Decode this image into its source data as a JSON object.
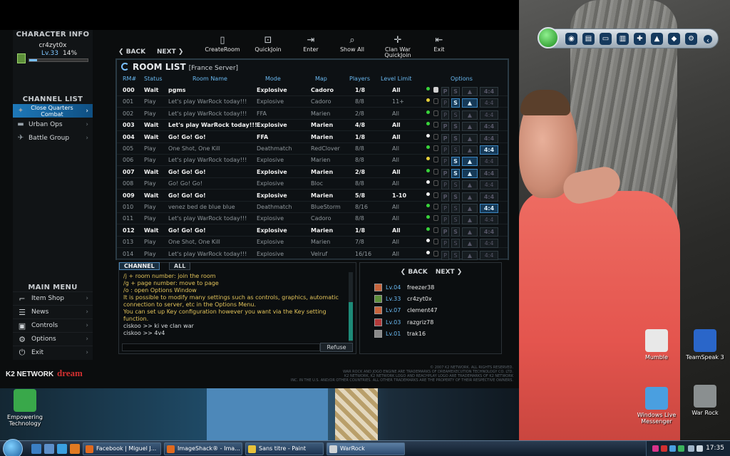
{
  "character_info": {
    "title": "CHARACTER INFO",
    "name": "cr4zyt0x",
    "level": "Lv.33",
    "xp_percent": "14%",
    "xp_fraction": 0.14
  },
  "channel_list": {
    "title": "CHANNEL LIST",
    "items": [
      {
        "label": "Close Quarters Combat",
        "active": true
      },
      {
        "label": "Urban Ops",
        "active": false
      },
      {
        "label": "Battle Group",
        "active": false
      }
    ]
  },
  "main_menu": {
    "title": "MAIN MENU",
    "items": [
      {
        "label": "Item Shop",
        "icon": "gun-icon"
      },
      {
        "label": "News",
        "icon": "news-icon"
      },
      {
        "label": "Controls",
        "icon": "controls-icon"
      },
      {
        "label": "Options",
        "icon": "gear-icon"
      },
      {
        "label": "Exit",
        "icon": "power-icon"
      }
    ]
  },
  "toolbar": {
    "back": "BACK",
    "next": "NEXT",
    "tools": [
      {
        "label": "CreateRoom",
        "icon": "create-room-icon"
      },
      {
        "label": "QuickJoin",
        "icon": "quick-join-icon"
      },
      {
        "label": "Enter",
        "icon": "enter-icon"
      },
      {
        "label": "Show All",
        "icon": "search-icon"
      },
      {
        "label": "Clan War QuickJoin",
        "icon": "clan-war-icon"
      },
      {
        "label": "Exit",
        "icon": "exit-icon"
      }
    ]
  },
  "room_list": {
    "title": "ROOM LIST",
    "server": "[France Server]",
    "columns": [
      "RM#",
      "Status",
      "Room Name",
      "Mode",
      "Map",
      "Players",
      "Level Limit",
      "Options"
    ],
    "rows": [
      {
        "num": "000",
        "status": "Wait",
        "name": "pgms",
        "mode": "Explosive",
        "map": "Cadoro",
        "players": "1/8",
        "level": "All",
        "dot": "green",
        "locked": true,
        "badge": ""
      },
      {
        "num": "001",
        "status": "Play",
        "name": "Let's play WarRock today!!!",
        "mode": "Explosive",
        "map": "Cadoro",
        "players": "8/8",
        "level": "11+",
        "dot": "yellow",
        "locked": false,
        "badge": "S"
      },
      {
        "num": "002",
        "status": "Play",
        "name": "Let's play WarRock today!!!",
        "mode": "FFA",
        "map": "Marien",
        "players": "2/8",
        "level": "All",
        "dot": "green",
        "locked": false,
        "badge": ""
      },
      {
        "num": "003",
        "status": "Wait",
        "name": "Let's play WarRock today!!!",
        "mode": "Explosive",
        "map": "Marien",
        "players": "4/8",
        "level": "All",
        "dot": "green",
        "locked": false,
        "badge": ""
      },
      {
        "num": "004",
        "status": "Wait",
        "name": "Go! Go! Go!",
        "mode": "FFA",
        "map": "Marien",
        "players": "1/8",
        "level": "All",
        "dot": "white",
        "locked": false,
        "badge": ""
      },
      {
        "num": "005",
        "status": "Play",
        "name": "One Shot, One Kill",
        "mode": "Deathmatch",
        "map": "RedClover",
        "players": "8/8",
        "level": "All",
        "dot": "green",
        "locked": false,
        "badge": "4:4"
      },
      {
        "num": "006",
        "status": "Play",
        "name": "Let's play WarRock today!!!",
        "mode": "Explosive",
        "map": "Marien",
        "players": "8/8",
        "level": "All",
        "dot": "yellow",
        "locked": false,
        "badge": "S"
      },
      {
        "num": "007",
        "status": "Wait",
        "name": "Go! Go! Go!",
        "mode": "Explosive",
        "map": "Marien",
        "players": "2/8",
        "level": "All",
        "dot": "green",
        "locked": false,
        "badge": "S"
      },
      {
        "num": "008",
        "status": "Play",
        "name": "Go! Go! Go!",
        "mode": "Explosive",
        "map": "Bloc",
        "players": "8/8",
        "level": "All",
        "dot": "white",
        "locked": false,
        "badge": ""
      },
      {
        "num": "009",
        "status": "Wait",
        "name": "Go! Go! Go!",
        "mode": "Explosive",
        "map": "Marien",
        "players": "5/8",
        "level": "1-10",
        "dot": "white",
        "locked": false,
        "badge": ""
      },
      {
        "num": "010",
        "status": "Play",
        "name": "venez bed de blue blue",
        "mode": "Deathmatch",
        "map": "BlueStorm",
        "players": "8/16",
        "level": "All",
        "dot": "green",
        "locked": false,
        "badge": "4:4"
      },
      {
        "num": "011",
        "status": "Play",
        "name": "Let's play WarRock today!!!",
        "mode": "Explosive",
        "map": "Cadoro",
        "players": "8/8",
        "level": "All",
        "dot": "green",
        "locked": false,
        "badge": ""
      },
      {
        "num": "012",
        "status": "Wait",
        "name": "Go! Go! Go!",
        "mode": "Explosive",
        "map": "Marien",
        "players": "1/8",
        "level": "All",
        "dot": "green",
        "locked": false,
        "badge": ""
      },
      {
        "num": "013",
        "status": "Play",
        "name": "One Shot, One Kill",
        "mode": "Explosive",
        "map": "Marien",
        "players": "7/8",
        "level": "All",
        "dot": "white",
        "locked": false,
        "badge": ""
      },
      {
        "num": "014",
        "status": "Play",
        "name": "Let's play WarRock today!!!",
        "mode": "Explosive",
        "map": "Velruf",
        "players": "16/16",
        "level": "All",
        "dot": "white",
        "locked": false,
        "badge": ""
      }
    ]
  },
  "chat": {
    "tabs": [
      "CHANNEL",
      "ALL"
    ],
    "lines": [
      {
        "text": "/j + room number: join the room",
        "color": "#e2c35a"
      },
      {
        "text": "/g + page number: move to page",
        "color": "#e2c35a"
      },
      {
        "text": "/o : open Options Window",
        "color": "#e2c35a"
      },
      {
        "text": "It is possible to modify many settings such as controls, graphics, automatic",
        "color": "#e2c35a"
      },
      {
        "text": "connection to server, etc in the Options Menu.",
        "color": "#e2c35a"
      },
      {
        "text": "You can set up Key configuration however you want via the Key setting",
        "color": "#e2c35a"
      },
      {
        "text": "function.",
        "color": "#e2c35a"
      },
      {
        "text": "ciskoo    >> ki ve clan war",
        "color": "#d8dcdf"
      },
      {
        "text": "ciskoo    >> 4v4",
        "color": "#d8dcdf"
      }
    ],
    "refuse_label": "Refuse"
  },
  "player_list": {
    "back": "BACK",
    "next": "NEXT",
    "players": [
      {
        "level": "Lv.04",
        "name": "freezer38",
        "badge_color": "#c8643c"
      },
      {
        "level": "Lv.33",
        "name": "cr4zyt0x",
        "badge_color": "#5d8f3a"
      },
      {
        "level": "Lv.07",
        "name": "clement47",
        "badge_color": "#c8643c"
      },
      {
        "level": "Lv.03",
        "name": "razgriz78",
        "badge_color": "#b33a3a"
      },
      {
        "level": "Lv.01",
        "name": "trak16",
        "badge_color": "#8a8a8a"
      }
    ]
  },
  "footer": {
    "k2": "K2 NETWORK",
    "dream": "dream",
    "legal": [
      "© 2007 K2 NETWORK. ALL RIGHTS RESERVED.",
      "WAR ROCK AND JOGO ENGINE ARE TRADEMARKS OF DREAMEXECUTION TECHNOLOGY CO. LTD.",
      "K2 NETWORK, K2 NETWORK LOGO AND REACHPLAY LOGO ARE TRADEMARKS OF K2 NETWORK",
      "INC. IN THE U.S. AND/OR OTHER COUNTRIES. ALL OTHER TRADEMARKS ARE THE PROPERTY OF THEIR RESPECTIVE OWNERS."
    ]
  },
  "desktop": {
    "icons": [
      {
        "label": "Empowering Technology",
        "color": "#39a84a"
      },
      {
        "label": "Mumble",
        "color": "#e8e8e8"
      },
      {
        "label": "TeamSpeak 3",
        "color": "#2a66c9"
      },
      {
        "label": "Windows Live Messenger",
        "color": "#4a9fe0"
      },
      {
        "label": "War Rock",
        "color": "#8a8f90"
      }
    ]
  },
  "taskbar": {
    "tasks": [
      {
        "label": "Facebook | Miguel J...",
        "icon_color": "#e06a1e",
        "active": false
      },
      {
        "label": "ImageShack® - Ima...",
        "icon_color": "#e06a1e",
        "active": false
      },
      {
        "label": "Sans titre - Paint",
        "icon_color": "#e7c23a",
        "active": false
      },
      {
        "label": "WarRock",
        "icon_color": "#cfd3d6",
        "active": true
      }
    ],
    "clock": "17:35"
  }
}
